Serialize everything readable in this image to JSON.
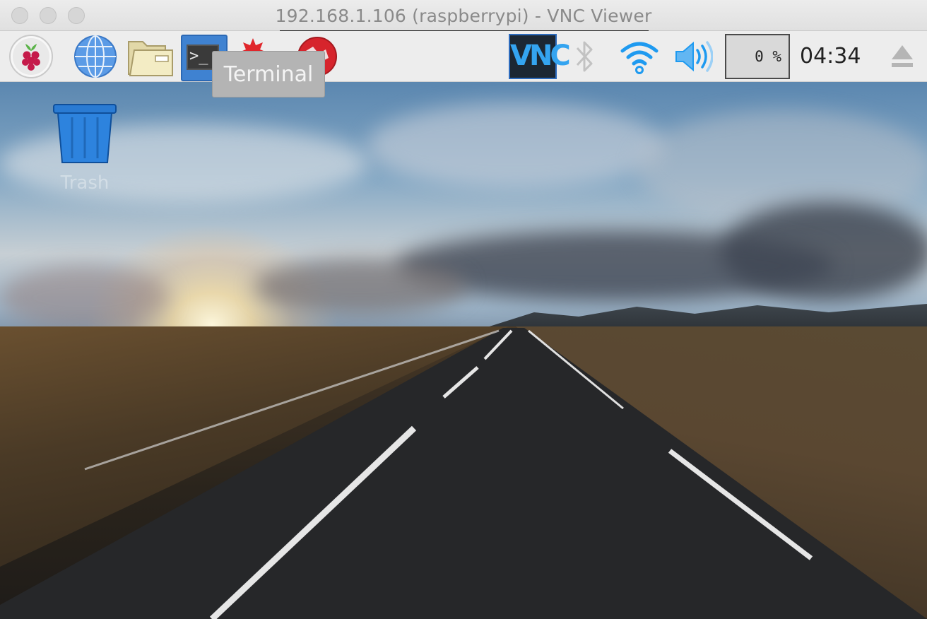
{
  "window": {
    "title": "192.168.1.106 (raspberrypi) - VNC Viewer"
  },
  "panel": {
    "launchers": [
      {
        "name": "Menu",
        "icon": "raspberry-pi-icon"
      },
      {
        "name": "Web Browser",
        "icon": "globe-icon"
      },
      {
        "name": "File Manager",
        "icon": "folder-icon"
      },
      {
        "name": "Terminal",
        "icon": "terminal-icon"
      },
      {
        "name": "Mathematica",
        "icon": "mathematica-icon"
      },
      {
        "name": "Wolfram",
        "icon": "wolfram-icon"
      }
    ],
    "terminal_prompt": ">_",
    "tray": {
      "vnc_label": "VNC",
      "bluetooth_icon": "bluetooth-icon",
      "wifi_icon": "wifi-icon",
      "volume_icon": "volume-icon",
      "cpu_usage": "0 %",
      "clock": "04:34",
      "eject_icon": "eject-icon"
    }
  },
  "tooltip": {
    "text": "Terminal"
  },
  "desktop": {
    "icons": [
      {
        "label": "Trash",
        "icon": "trash-icon"
      }
    ]
  },
  "colors": {
    "panel_bg": "#ededed",
    "accent_blue": "#3f82d1",
    "vnc_bg": "#1c2733",
    "tray_blue": "#1e9af0"
  }
}
